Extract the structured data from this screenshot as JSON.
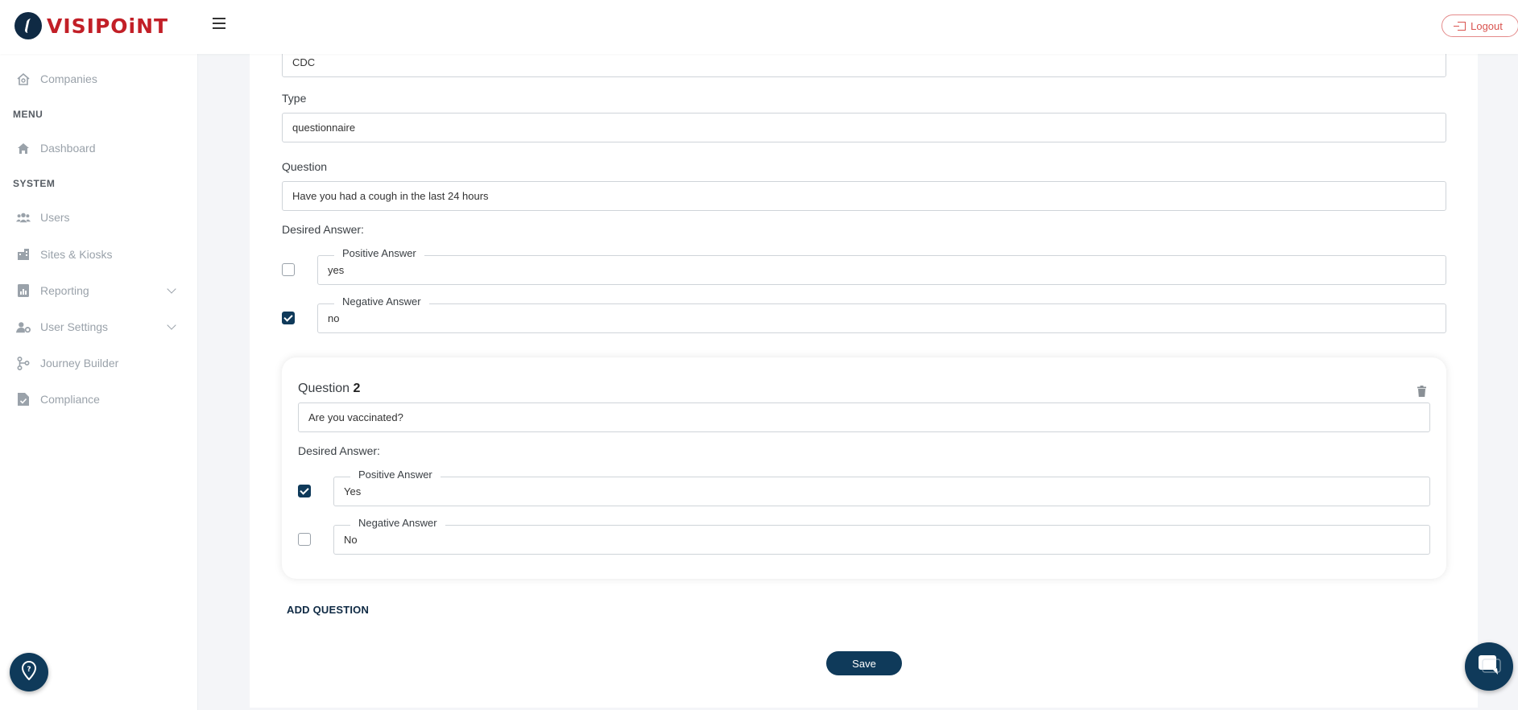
{
  "brand": {
    "logo_text": "VISIPOiNT",
    "accent": "#c21f27",
    "primary": "#0f3a5a"
  },
  "header": {
    "logout_label": "Logout"
  },
  "sidebar": {
    "companies": "Companies",
    "menu_heading": "MENU",
    "dashboard": "Dashboard",
    "system_heading": "SYSTEM",
    "users": "Users",
    "sites": "Sites & Kiosks",
    "reporting": "Reporting",
    "user_settings": "User Settings",
    "journey_builder": "Journey Builder",
    "compliance": "Compliance"
  },
  "form": {
    "name_value": "CDC",
    "type_label": "Type",
    "type_value": "questionnaire",
    "question_label": "Question",
    "question_value": "Have you had a cough in the last 24 hours",
    "desired_label": "Desired Answer:",
    "q1": {
      "positive_legend": "Positive Answer",
      "positive_value": "yes",
      "positive_checked": false,
      "negative_legend": "Negative Answer",
      "negative_value": "no",
      "negative_checked": true
    },
    "q2": {
      "title_prefix": "Question",
      "title_number": "2",
      "question_value": "Are you  vaccinated?",
      "desired_label": "Desired Answer:",
      "positive_legend": "Positive Answer",
      "positive_value": "Yes",
      "positive_checked": true,
      "negative_legend": "Negative Answer",
      "negative_value": "No",
      "negative_checked": false
    },
    "add_question_label": "ADD QUESTION",
    "save_label": "Save"
  }
}
